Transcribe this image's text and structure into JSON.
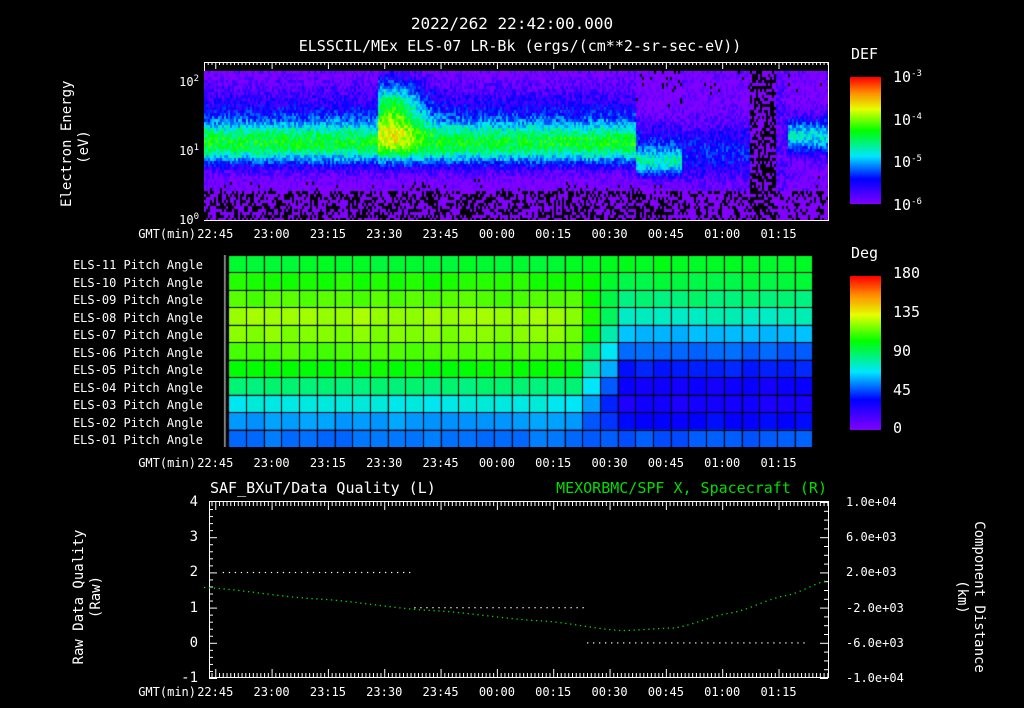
{
  "header": {
    "timestamp": "2022/262 22:42:00.000",
    "title": "ELSSCIL/MEx ELS-07 LR-Bk  (ergs/(cm**2-sr-sec-eV))"
  },
  "time_axis": {
    "label": "GMT(min)",
    "ticks": [
      "22:45",
      "23:00",
      "23:15",
      "23:30",
      "23:45",
      "00:00",
      "00:15",
      "00:30",
      "00:45",
      "01:00",
      "01:15"
    ]
  },
  "chart_data": [
    {
      "type": "heatmap",
      "name": "electron-spectrogram",
      "ylabel": [
        "Electron Energy",
        "(eV)"
      ],
      "yscale": "log",
      "ylim": [
        1,
        140
      ],
      "y_ticks": [
        {
          "base": "10",
          "exp": "2"
        },
        {
          "base": "10",
          "exp": "1"
        },
        {
          "base": "10",
          "exp": "0"
        }
      ],
      "x_range_minutes_after_2242": [
        0,
        166
      ],
      "colorbar": {
        "label": "DEF",
        "scale": "log",
        "range": [
          1e-06,
          0.001
        ],
        "ticks": [
          {
            "base": "10",
            "exp": "-3"
          },
          {
            "base": "10",
            "exp": "-4"
          },
          {
            "base": "10",
            "exp": "-5"
          },
          {
            "base": "10",
            "exp": "-6"
          }
        ]
      },
      "features": [
        {
          "desc_t": [
            0,
            115
          ],
          "peak_energy_eV": 13,
          "log_def": -4.6
        },
        {
          "desc_t": [
            46,
            68
          ],
          "peak_energy_eV": 25,
          "log_def": -4.1
        },
        {
          "desc_t": [
            115,
            125
          ],
          "peak_energy_eV": 7,
          "log_def": -4.9
        },
        {
          "desc_t": [
            145,
            152
          ],
          "peak_energy_eV": 10,
          "log_def": -6.5
        },
        {
          "desc_t": [
            156,
            166
          ],
          "peak_energy_eV": 15,
          "log_def": -4.7
        }
      ]
    },
    {
      "type": "heatmap",
      "name": "pitch-angle-grid",
      "rows": [
        "ELS-11 Pitch Angle",
        "ELS-10 Pitch Angle",
        "ELS-09 Pitch Angle",
        "ELS-08 Pitch Angle",
        "ELS-07 Pitch Angle",
        "ELS-06 Pitch Angle",
        "ELS-05 Pitch Angle",
        "ELS-04 Pitch Angle",
        "ELS-03 Pitch Angle",
        "ELS-02 Pitch Angle",
        "ELS-01 Pitch Angle"
      ],
      "pitch_angle_early_deg": [
        98,
        108,
        115,
        125,
        122,
        115,
        105,
        88,
        72,
        58,
        52
      ],
      "pitch_angle_late_deg": [
        100,
        95,
        88,
        78,
        62,
        50,
        40,
        32,
        30,
        36,
        48
      ],
      "transition_minutes_after_2242": [
        98,
        112
      ],
      "data_range_minutes_after_2242": [
        6.5,
        162
      ],
      "colorbar": {
        "label": "Deg",
        "range": [
          0,
          180
        ],
        "ticks": [
          "180",
          "135",
          "90",
          "45",
          "0"
        ]
      }
    },
    {
      "type": "line",
      "name": "data-quality-and-position",
      "title_left": "SAF_BXuT/Data Quality (L)",
      "title_right": "MEXORBMC/SPF X, Spacecraft (R)",
      "ylabel_left": [
        "Raw Data Quality",
        "(Raw)"
      ],
      "ylabel_right": [
        "Component Distance",
        "(km)"
      ],
      "ylim_left": [
        -1,
        4
      ],
      "yticks_left": [
        "4",
        "3",
        "2",
        "1",
        "0",
        "-1"
      ],
      "ylim_right": [
        -10000,
        10000
      ],
      "yticks_right": [
        "1.0e+04",
        "6.0e+03",
        "2.0e+03",
        "-2.0e+03",
        "-6.0e+03",
        "-1.0e+04"
      ],
      "series": [
        {
          "name": "Data Quality",
          "color": "#ffffff",
          "segments": [
            {
              "t": [
                5,
                56
              ],
              "value": 2
            },
            {
              "t": [
                56,
                102
              ],
              "value": 1
            },
            {
              "t": [
                102,
                160
              ],
              "value": 0
            }
          ]
        },
        {
          "name": "SPF X",
          "color": "#00dd00",
          "t": [
            0,
            30,
            60,
            90,
            111,
            125,
            140,
            155,
            166
          ],
          "values": [
            300,
            -1000,
            -2300,
            -3500,
            -4600,
            -4300,
            -2600,
            -600,
            1100
          ]
        }
      ]
    }
  ]
}
